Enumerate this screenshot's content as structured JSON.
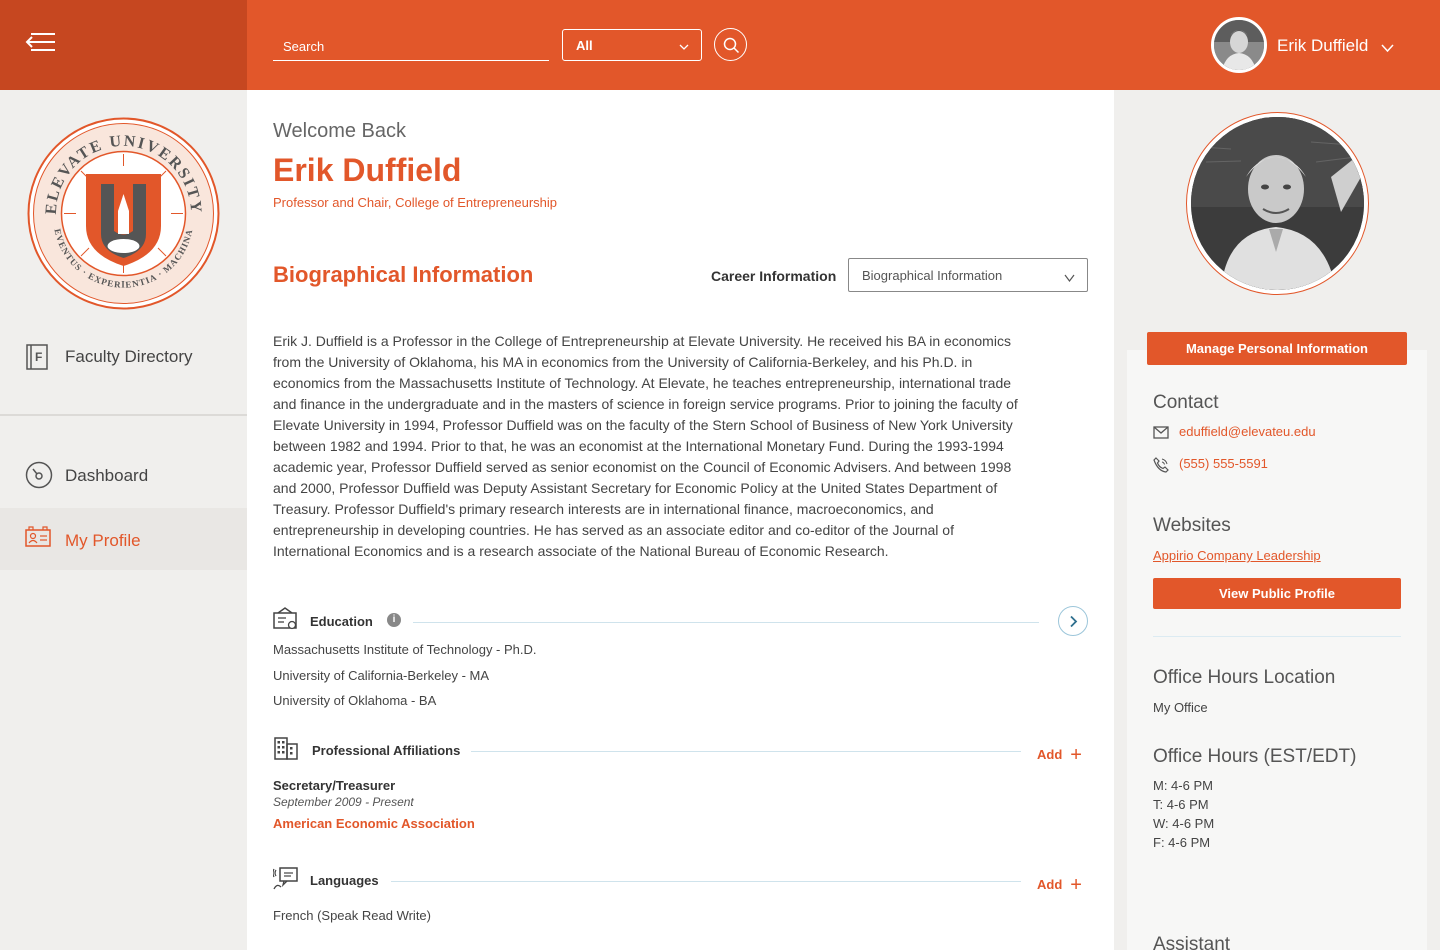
{
  "header": {
    "search_placeholder": "Search",
    "filter_value": "All",
    "user_name": "Erik Duffield"
  },
  "sidebar": {
    "seal": {
      "top_text": "ELEVATE UNIVERSITY",
      "bottom_text": "EVENTUS · EXPERIENTIA · MACHINA"
    },
    "items": [
      {
        "label": "Faculty Directory",
        "icon": "directory-icon"
      },
      {
        "label": "Dashboard",
        "icon": "dashboard-gauge-icon"
      },
      {
        "label": "My Profile",
        "icon": "profile-card-icon",
        "active": true
      }
    ]
  },
  "main": {
    "welcome": "Welcome Back",
    "name": "Erik Duffield",
    "title": "Professor and Chair, College of Entrepreneurship",
    "bio_heading": "Biographical Information",
    "career_label": "Career Information",
    "career_select_value": "Biographical Information",
    "bio": "Erik J. Duffield is a Professor in the College of Entrepreneurship at Elevate University. He received his BA in economics from the University of Oklahoma, his MA in economics from the University of California-Berkeley, and his Ph.D. in economics from the Massachusetts Institute of Technology. At Elevate, he teaches entrepreneurship, international trade and finance in the undergraduate and in the masters of science in foreign service programs. Prior to joining the faculty of Elevate University in 1994, Professor Duffield was on the faculty of the Stern School of Business of New York University between 1982 and 1994. Prior to that, he was an economist at the International Monetary Fund. During the 1993-1994 academic year, Professor Duffield served as senior economist on the Council of Economic Advisers. And between 1998 and 2000, Professor Duffield was Deputy Assistant Secretary for Economic Policy at the United States Department of Treasury. Professor Duffield's primary research interests are in international finance, macroeconomics, and entrepreneurship in developing countries. He has served as an associate editor and co-editor of the Journal of International Economics and is a research associate of the National Bureau of Economic Research.",
    "education": {
      "title": "Education",
      "info_icon": "i",
      "items": [
        "Massachusetts Institute of Technology - Ph.D.",
        "University of California-Berkeley - MA",
        "University of Oklahoma - BA"
      ]
    },
    "affiliations": {
      "title": "Professional Affiliations",
      "add_label": "Add",
      "role": "Secretary/Treasurer",
      "dates": "September 2009 - Present",
      "org": "American Economic Association"
    },
    "languages": {
      "title": "Languages",
      "add_label": "Add",
      "items": [
        "French (Speak Read Write)"
      ]
    }
  },
  "right": {
    "manage_label": "Manage Personal Information",
    "contact_heading": "Contact",
    "email": "eduffield@elevateu.edu",
    "phone": "(555) 555-5591",
    "websites_heading": "Websites",
    "website_link": "Appirio Company Leadership",
    "view_public_label": "View Public Profile",
    "office_location_heading": "Office Hours Location",
    "office_location": "My Office",
    "office_hours_heading": "Office Hours  (EST/EDT)",
    "hours": [
      "M: 4-6 PM",
      "T: 4-6 PM",
      "W: 4-6 PM",
      "F: 4-6 PM"
    ],
    "assistant_heading": "Assistant"
  },
  "colors": {
    "brand": "#e2572a",
    "brand_dark": "#c64720",
    "accent_line": "#cfe3ec"
  }
}
